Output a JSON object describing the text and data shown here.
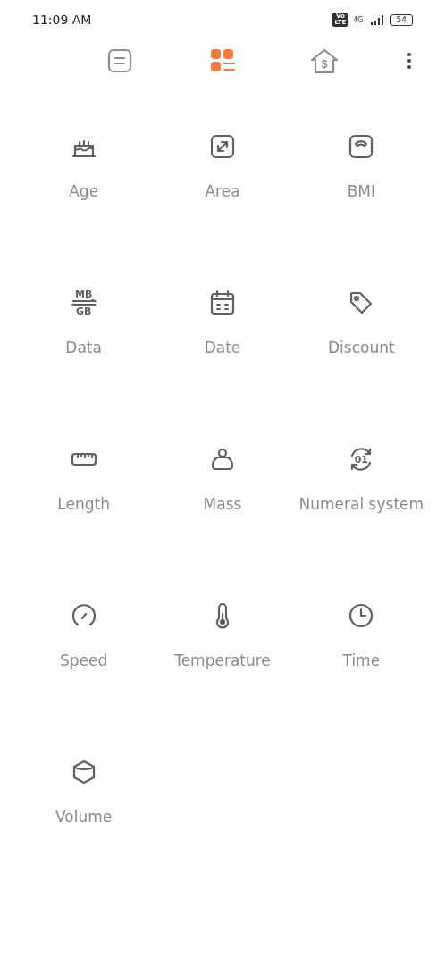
{
  "status_bar": {
    "time": "11:09 AM",
    "volte": [
      "Vo",
      "LTE"
    ],
    "network": "4G",
    "battery": "54"
  },
  "tabs": [
    {
      "kind": "history",
      "selected": false
    },
    {
      "kind": "calculator",
      "selected": true
    },
    {
      "kind": "finance",
      "selected": false,
      "glyph": "$"
    }
  ],
  "converters": [
    {
      "kind": "cake",
      "label": "Age"
    },
    {
      "kind": "resize",
      "label": "Area"
    },
    {
      "kind": "scale",
      "label": "BMI"
    },
    {
      "kind": "data",
      "label": "Data",
      "icon_text": [
        "MB",
        "GB"
      ]
    },
    {
      "kind": "calendar",
      "label": "Date"
    },
    {
      "kind": "tag",
      "label": "Discount"
    },
    {
      "kind": "ruler",
      "label": "Length"
    },
    {
      "kind": "weight",
      "label": "Mass"
    },
    {
      "kind": "numeral",
      "label": "Numeral system",
      "icon_text": [
        "01"
      ]
    },
    {
      "kind": "gauge",
      "label": "Speed"
    },
    {
      "kind": "thermometer",
      "label": "Temperature"
    },
    {
      "kind": "clock",
      "label": "Time"
    },
    {
      "kind": "cube",
      "label": "Volume"
    }
  ]
}
